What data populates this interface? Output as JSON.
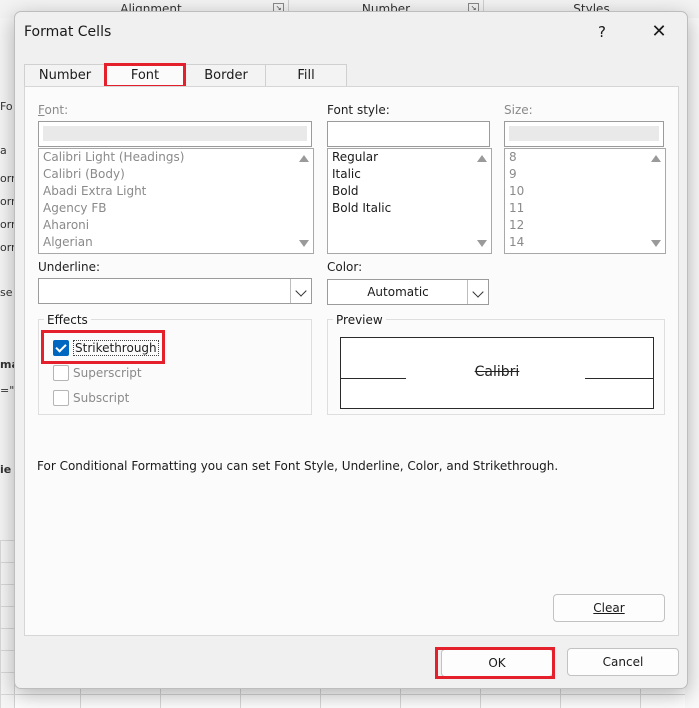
{
  "background": {
    "ribbon_groups": [
      "Alignment",
      "Number",
      "Styles"
    ],
    "left_fragments": [
      "Fo",
      "a",
      "orm",
      "orm",
      "orm",
      "orm",
      "se",
      "ma",
      "=\"",
      "ie"
    ]
  },
  "dialog": {
    "title": "Format Cells",
    "help_label": "?",
    "close_label": "✕",
    "tabs": [
      {
        "label": "Number",
        "active": false
      },
      {
        "label": "Font",
        "active": true
      },
      {
        "label": "Border",
        "active": false
      },
      {
        "label": "Fill",
        "active": false
      }
    ]
  },
  "font": {
    "font_label": "Font:",
    "font_label_underline": "F",
    "font_label_rest": "ont:",
    "font_value": "",
    "font_list": [
      "Calibri Light (Headings)",
      "Calibri (Body)",
      "Abadi Extra Light",
      "Agency FB",
      "Aharoni",
      "Algerian"
    ],
    "style_label_underline": "O",
    "style_label_rest": "Font style:",
    "style_value": "",
    "style_list": [
      "Regular",
      "Italic",
      "Bold",
      "Bold Italic"
    ],
    "size_label": "Size:",
    "size_value": "",
    "size_list": [
      "8",
      "9",
      "10",
      "11",
      "12",
      "14"
    ],
    "underline_label": "Underline:",
    "underline_value": "",
    "color_label": "Color:",
    "color_value": "Automatic"
  },
  "effects": {
    "title": "Effects",
    "strikethrough_label": "Strikethrough",
    "strikethrough_checked": true,
    "superscript_label": "Superscript",
    "subscript_label": "Subscript"
  },
  "preview": {
    "title": "Preview",
    "sample_text": "Calibri"
  },
  "note": "For Conditional Formatting you can set Font Style, Underline, Color, and Strikethrough.",
  "buttons": {
    "clear": "Clear",
    "ok": "OK",
    "cancel": "Cancel"
  },
  "colors": {
    "highlight": "#e3202b",
    "checkbox_accent": "#0067c0"
  }
}
